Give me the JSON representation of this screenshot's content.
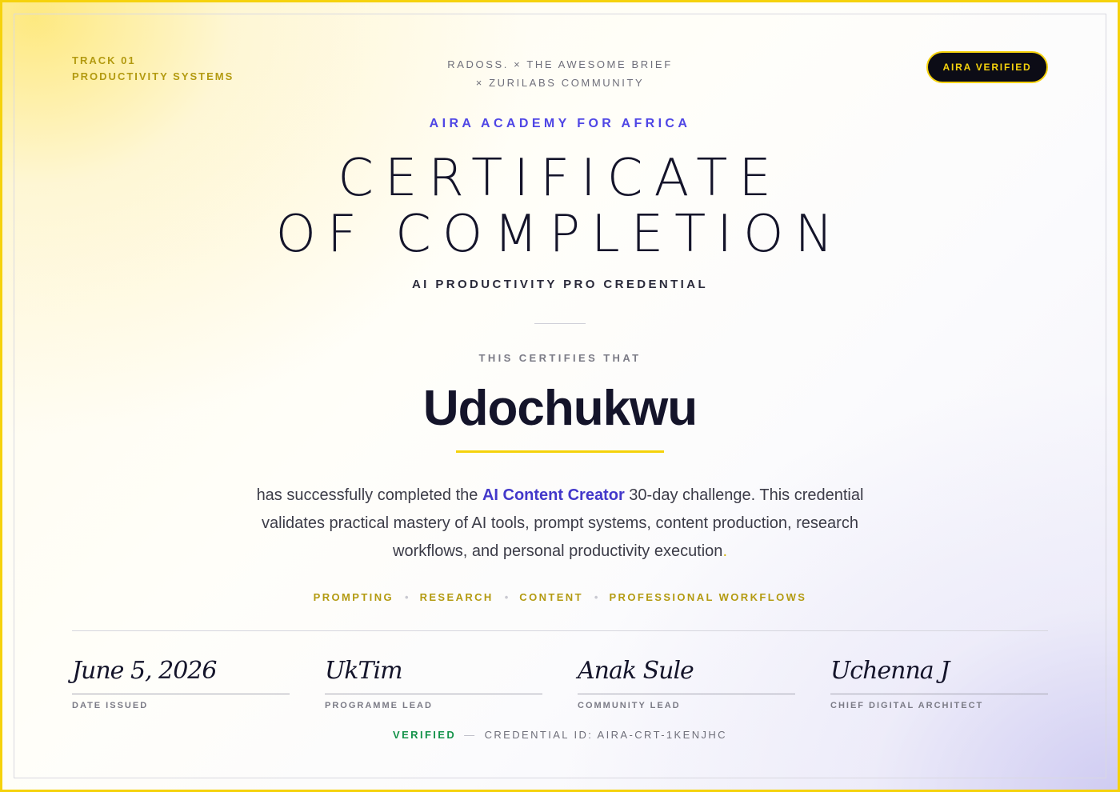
{
  "track": {
    "line1": "TRACK 01",
    "line2": "PRODUCTIVITY SYSTEMS"
  },
  "partners": {
    "line1": "RADOSS. × THE AWESOME BRIEF",
    "line2": "× ZURILABS COMMUNITY"
  },
  "badge": {
    "label": "AIRA VERIFIED"
  },
  "academy": "AIRA ACADEMY FOR AFRICA",
  "title": {
    "line1": "CERTIFICATE",
    "line2": "OF COMPLETION"
  },
  "credential_name": "AI PRODUCTIVITY PRO CREDENTIAL",
  "certifies_label": "THIS CERTIFIES THAT",
  "recipient": "Udochukwu",
  "description": {
    "before": "has successfully completed the ",
    "highlight": "AI Content Creator",
    "after": " 30-day challenge. This credential validates practical mastery of AI tools, prompt systems, content production, research workflows, and personal productivity execution",
    "end": "."
  },
  "skills": [
    "PROMPTING",
    "RESEARCH",
    "CONTENT",
    "PROFESSIONAL WORKFLOWS"
  ],
  "skill_separator": "•",
  "signatures": [
    {
      "script": "June 5, 2026",
      "label": "DATE ISSUED"
    },
    {
      "script": "UkTim",
      "label": "PROGRAMME LEAD"
    },
    {
      "script": "Anak Sule",
      "label": "COMMUNITY LEAD"
    },
    {
      "script": "Uchenna J",
      "label": "CHIEF DIGITAL ARCHITECT"
    }
  ],
  "footer": {
    "verified": "VERIFIED",
    "dash": "—",
    "credential_id": "CREDENTIAL ID: AIRA-CRT-1KENJHC"
  },
  "colors": {
    "border": "#f5d20c",
    "accent": "#4f46e5",
    "gold": "#b39a10",
    "verified": "#15934a",
    "ink": "#14142a"
  }
}
